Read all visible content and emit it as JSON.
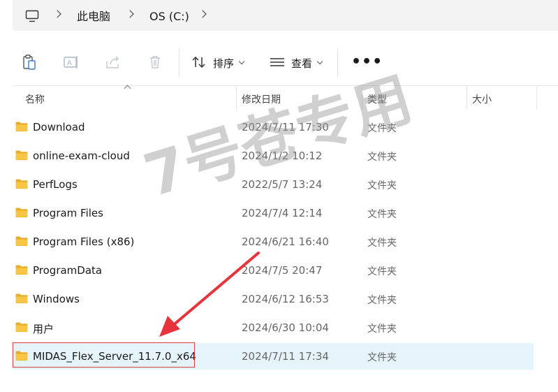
{
  "address": {
    "segments": [
      "此电脑",
      "OS (C:)"
    ]
  },
  "toolbar": {
    "sort_label": "排序",
    "view_label": "查看",
    "more_label": "•••"
  },
  "columns": {
    "name": "名称",
    "modified": "修改日期",
    "type": "类型",
    "size": "大小"
  },
  "files": [
    {
      "name": "Download",
      "modified": "2024/7/11 17:30",
      "type": "文件夹"
    },
    {
      "name": "online-exam-cloud",
      "modified": "2024/1/2 10:12",
      "type": "文件夹"
    },
    {
      "name": "PerfLogs",
      "modified": "2022/5/7 13:24",
      "type": "文件夹"
    },
    {
      "name": "Program Files",
      "modified": "2024/7/4 12:14",
      "type": "文件夹"
    },
    {
      "name": "Program Files (x86)",
      "modified": "2024/6/21 16:40",
      "type": "文件夹"
    },
    {
      "name": "ProgramData",
      "modified": "2024/7/5 20:47",
      "type": "文件夹"
    },
    {
      "name": "Windows",
      "modified": "2024/6/12 16:53",
      "type": "文件夹"
    },
    {
      "name": "用户",
      "modified": "2024/6/30 10:04",
      "type": "文件夹"
    },
    {
      "name": "MIDAS_Flex_Server_11.7.0_x64",
      "modified": "2024/7/11 17:34",
      "type": "文件夹"
    }
  ],
  "watermark": "7号苍专用",
  "colors": {
    "folder": "#f8c644",
    "folder_dark": "#e9ad2a",
    "selected_row": "#e5f3fb",
    "annotation": "#e0404a"
  }
}
